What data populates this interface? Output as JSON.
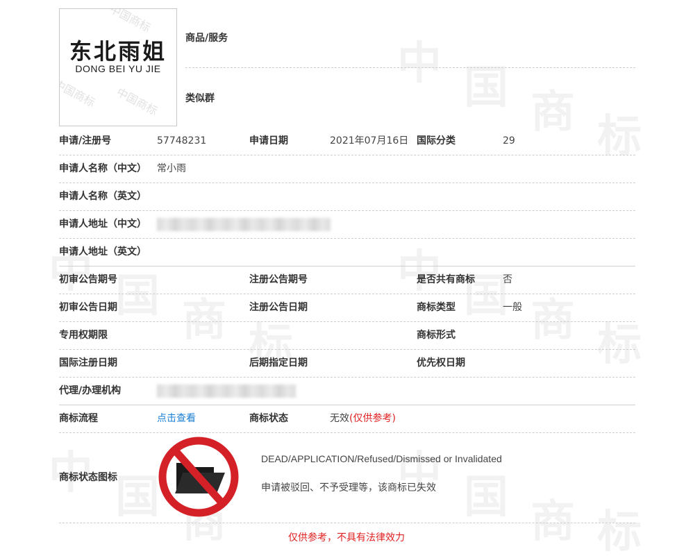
{
  "logo": {
    "cn_text": "东北雨姐",
    "en_text": "DONG BEI YU JIE",
    "watermark_text": "中国商标"
  },
  "page_watermark": [
    "中",
    "国",
    "商",
    "标"
  ],
  "goods_services_label": "商品/服务",
  "similar_group_label": "类似群",
  "fields": {
    "reg_no_label": "申请/注册号",
    "reg_no_value": "57748231",
    "apply_date_label": "申请日期",
    "apply_date_value": "2021年07月16日",
    "intl_class_label": "国际分类",
    "intl_class_value": "29",
    "applicant_cn_label": "申请人名称（中文）",
    "applicant_cn_value": "常小雨",
    "applicant_en_label": "申请人名称（英文）",
    "address_cn_label": "申请人地址（中文）",
    "address_en_label": "申请人地址（英文）",
    "prelim_pub_no_label": "初审公告期号",
    "reg_pub_no_label": "注册公告期号",
    "shared_mark_label": "是否共有商标",
    "shared_mark_value": "否",
    "prelim_pub_date_label": "初审公告日期",
    "reg_pub_date_label": "注册公告日期",
    "mark_type_label": "商标类型",
    "mark_type_value": "一般",
    "exclusive_period_label": "专用权期限",
    "mark_form_label": "商标形式",
    "intl_reg_date_label": "国际注册日期",
    "later_designation_label": "后期指定日期",
    "priority_date_label": "优先权日期",
    "agent_label": "代理/办理机构",
    "process_label": "商标流程",
    "process_link": "点击查看",
    "status_label": "商标状态",
    "status_value": "无效",
    "status_note": "(仅供参考)",
    "status_icon_label": "商标状态图标"
  },
  "status_icon": {
    "icon": "no-folder-icon",
    "en_text": "DEAD/APPLICATION/Refused/Dismissed or Invalidated",
    "cn_text": "申请被驳回、不予受理等，该商标已失效"
  },
  "footer_note": "仅供参考，不具有法律效力",
  "colors": {
    "link": "#1a7fd4",
    "warning": "#e02020",
    "prohibit": "#d42027"
  }
}
